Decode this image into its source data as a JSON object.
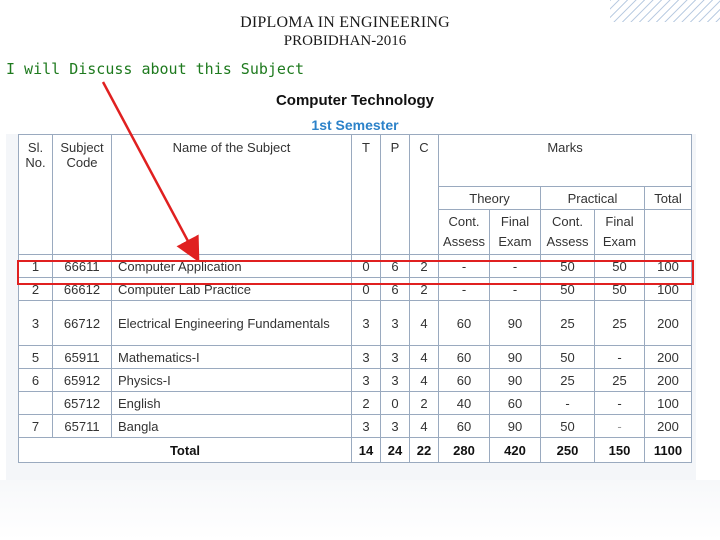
{
  "header": {
    "title_line1": "DIPLOMA IN ENGINEERING",
    "title_line2": "PROBIDHAN-2016"
  },
  "annotation": {
    "note": "I will Discuss about this Subject",
    "arrow_color": "#e02020"
  },
  "department": "Computer Technology",
  "semester": "1st Semester",
  "table": {
    "headers": {
      "sl_line1": "Sl.",
      "sl_line2": "No.",
      "code_line1": "Subject",
      "code_line2": "Code",
      "name": "Name of the Subject",
      "t": "T",
      "p": "P",
      "c": "C",
      "marks": "Marks",
      "theory": "Theory",
      "practical": "Practical",
      "total": "Total",
      "cont_line1": "Cont.",
      "cont_line2": "Assess",
      "final_line1": "Final",
      "final_line2": "Exam"
    },
    "rows": [
      {
        "sl": "1",
        "code": "66611",
        "name": "Computer Application",
        "t": "0",
        "p": "6",
        "c": "2",
        "th_cont": "-",
        "th_final": "-",
        "pr_cont": "50",
        "pr_final": "50",
        "total": "100"
      },
      {
        "sl": "2",
        "code": "66612",
        "name": "Computer Lab Practice",
        "t": "0",
        "p": "6",
        "c": "2",
        "th_cont": "-",
        "th_final": "-",
        "pr_cont": "50",
        "pr_final": "50",
        "total": "100"
      },
      {
        "sl": "3",
        "code": "66712",
        "name": "Electrical Engineering Fundamentals",
        "t": "3",
        "p": "3",
        "c": "4",
        "th_cont": "60",
        "th_final": "90",
        "pr_cont": "25",
        "pr_final": "25",
        "total": "200"
      },
      {
        "sl": "5",
        "code": "65911",
        "name": "Mathematics-I",
        "t": "3",
        "p": "3",
        "c": "4",
        "th_cont": "60",
        "th_final": "90",
        "pr_cont": "50",
        "pr_final": "-",
        "total": "200"
      },
      {
        "sl": "6",
        "code": "65912",
        "name": "Physics-I",
        "t": "3",
        "p": "3",
        "c": "4",
        "th_cont": "60",
        "th_final": "90",
        "pr_cont": "25",
        "pr_final": "25",
        "total": "200"
      },
      {
        "sl": "",
        "code": "65712",
        "name": "English",
        "t": "2",
        "p": "0",
        "c": "2",
        "th_cont": "40",
        "th_final": "60",
        "pr_cont": "-",
        "pr_final": "-",
        "total": "100"
      },
      {
        "sl": "7",
        "code": "65711",
        "name": "Bangla",
        "t": "3",
        "p": "3",
        "c": "4",
        "th_cont": "60",
        "th_final": "90",
        "pr_cont": "50",
        "pr_final": "-",
        "total": "200"
      }
    ],
    "totals": {
      "label": "Total",
      "t": "14",
      "p": "24",
      "c": "22",
      "th_cont": "280",
      "th_final": "420",
      "pr_cont": "250",
      "pr_final": "150",
      "total": "1100"
    }
  }
}
